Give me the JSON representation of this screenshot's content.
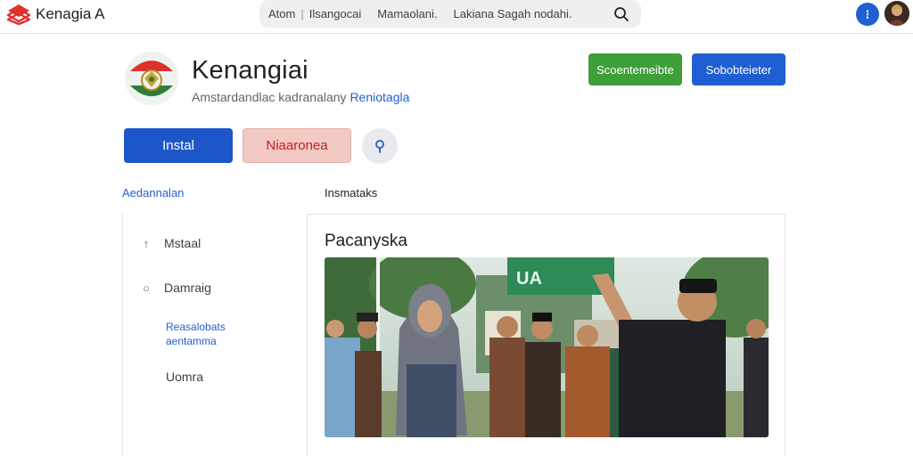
{
  "brand": {
    "name": "Kenagia A"
  },
  "topnav": {
    "items": [
      "Atom",
      "Ilsangocai",
      "Mamaolani.",
      "Lakiana Sagah nodahi."
    ],
    "search_icon": "search-icon"
  },
  "account": {
    "help_glyph": "⁝"
  },
  "app": {
    "title": "Kenangiai",
    "subtitle_text": "Amstardandlac kadranalany ",
    "subtitle_link": "Reniotagla"
  },
  "header_actions": {
    "green_label": "Scoentemeibte",
    "blue_label": "Sobobteieter"
  },
  "actions": {
    "install_label": "Instal",
    "uninstall_label": "Niaaronea",
    "share_icon": "share-icon"
  },
  "sidebar": {
    "heading": "Aedannalan",
    "items": [
      {
        "label": "Mstaal",
        "icon": "arrow-icon"
      },
      {
        "label": "Damraig",
        "icon": "circle-icon"
      }
    ],
    "sub_link_line1": "Reasalobats",
    "sub_link_line2": "aentamma",
    "last_item": "Uomra"
  },
  "main": {
    "heading": "Insmataks",
    "card_title": "Pacanyska"
  },
  "colors": {
    "primary": "#1f5fd1",
    "green": "#3e9e3a",
    "danger_bg": "#f2c9c3",
    "danger_text": "#c5221f",
    "brand_red": "#e0312b"
  }
}
